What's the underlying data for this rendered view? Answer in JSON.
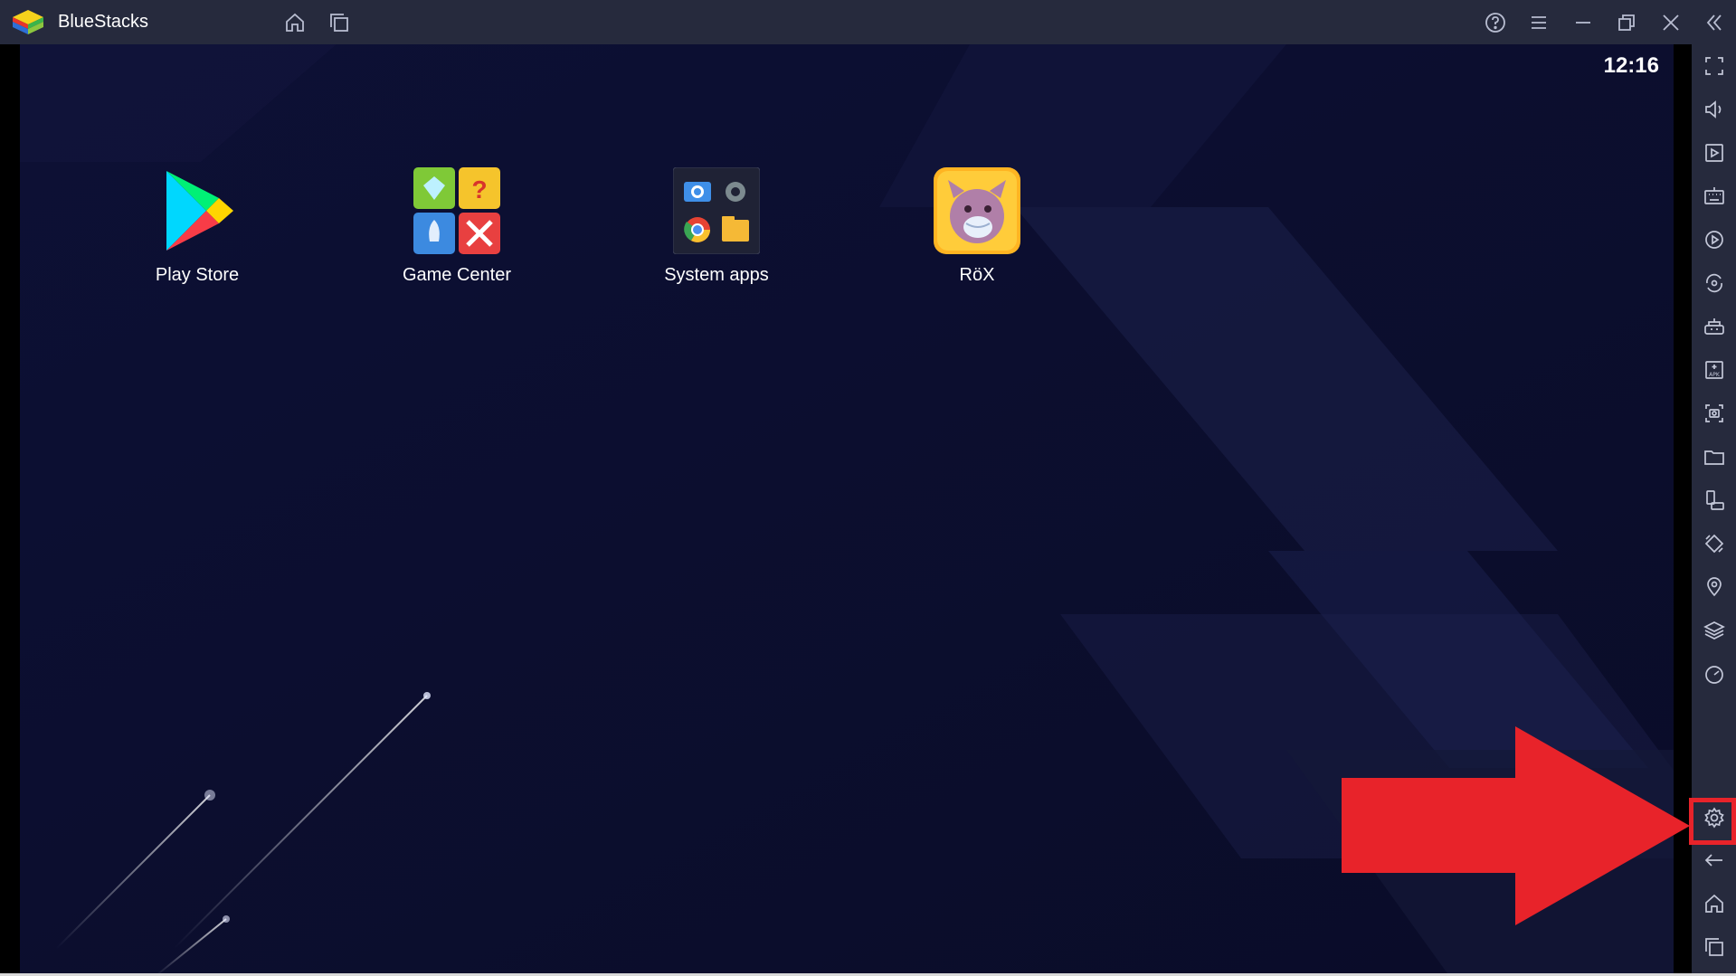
{
  "titlebar": {
    "app_name": "BlueStacks",
    "buttons": [
      "home-icon",
      "multi-instance-icon",
      "help-icon",
      "menu-icon",
      "minimize-icon",
      "restore-icon",
      "close-icon",
      "collapse-sidebar-icon"
    ]
  },
  "screen": {
    "clock": "12:16",
    "apps": [
      {
        "label": "Play Store",
        "icon": "play-store-icon"
      },
      {
        "label": "Game Center",
        "icon": "game-center-icon"
      },
      {
        "label": "System apps",
        "icon": "system-apps-icon"
      },
      {
        "label": "RöX",
        "icon": "rox-icon"
      }
    ]
  },
  "sidebar": {
    "items": [
      "fullscreen-icon",
      "volume-icon",
      "media-manager-icon",
      "keyboard-controls-icon",
      "macro-recorder-icon",
      "sync-icon",
      "game-controls-icon",
      "install-apk-icon",
      "screenshot-icon",
      "folder-icon",
      "rotate-icon",
      "shake-icon",
      "location-icon",
      "layers-icon",
      "performance-icon",
      "settings-icon",
      "back-icon",
      "home-icon",
      "recent-apps-icon"
    ]
  },
  "colors": {
    "titlebar": "#262a3d",
    "screen_bg": "#0b0d2e",
    "highlight": "#e8232a"
  }
}
